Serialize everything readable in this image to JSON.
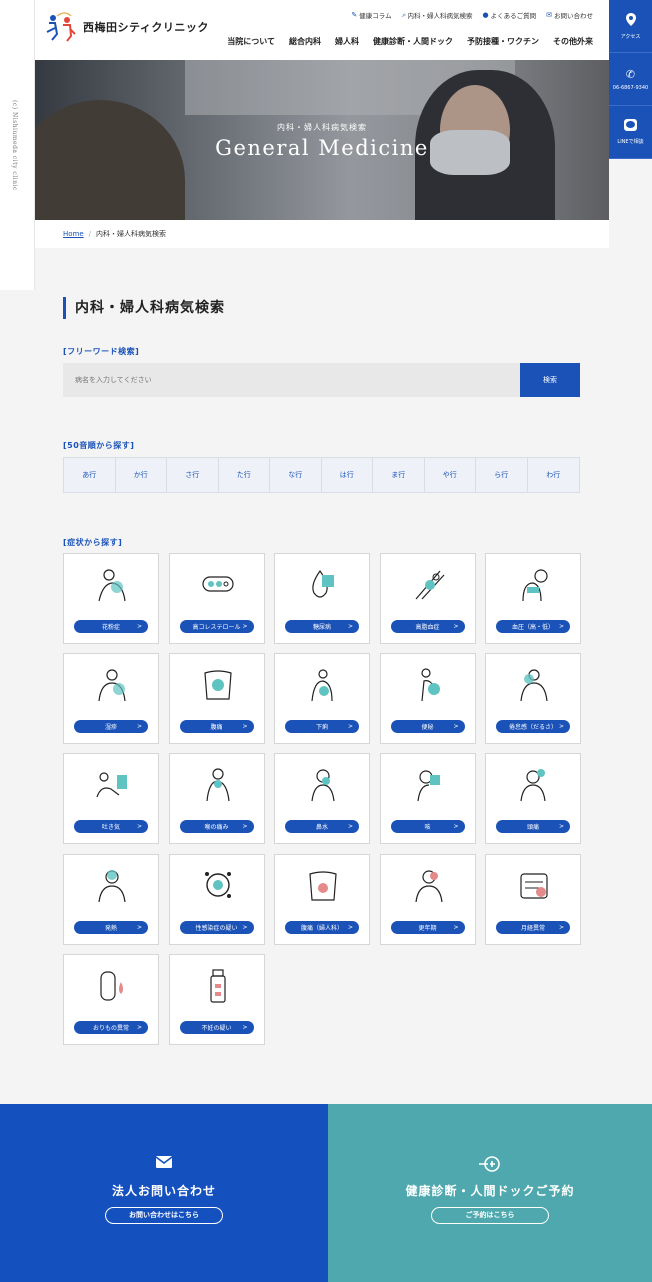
{
  "site": {
    "name": "西梅田シティクリニック",
    "copyright": "(c) Nishiumeda city clinic"
  },
  "utility_links": [
    "健康コラム",
    "内科・婦人科病気検索",
    "よくあるご質問",
    "お問い合わせ"
  ],
  "main_nav": [
    "当院について",
    "総合内科",
    "婦人科",
    "健康診断・人間ドック",
    "予防接種・ワクチン",
    "その他外来"
  ],
  "side_buttons": [
    {
      "label": "アクセス"
    },
    {
      "label": "06-6867-9340"
    },
    {
      "label": "LINEで相談"
    }
  ],
  "hero": {
    "subtitle": "内科・婦人科病気検索",
    "title": "General Medicine"
  },
  "breadcrumb": {
    "home": "Home",
    "current": "内科・婦人科病気検索"
  },
  "page_title": "内科・婦人科病気検索",
  "freeword": {
    "label": "[フリーワード検索]",
    "placeholder": "病名を入力してください",
    "button": "検索"
  },
  "gojuon": {
    "label": "[50音順から探す]",
    "items": [
      "あ行",
      "か行",
      "さ行",
      "た行",
      "な行",
      "は行",
      "ま行",
      "や行",
      "ら行",
      "わ行"
    ]
  },
  "symptoms": {
    "label": "[症状から探す]",
    "items": [
      "花粉症",
      "高コレステロール",
      "糖尿病",
      "高脂血症",
      "血圧（高・低）",
      "湿疹",
      "腹痛",
      "下痢",
      "便秘",
      "倦怠感（だるさ）",
      "吐き気",
      "喉の痛み",
      "鼻水",
      "咳",
      "頭痛",
      "発熱",
      "性感染症の疑い",
      "腹痛（婦人科）",
      "更年期",
      "月経異常",
      "おりもの異常",
      "不妊の疑い"
    ]
  },
  "cta": {
    "corporate": {
      "title": "法人お問い合わせ",
      "button": "お問い合わせはこちら"
    },
    "checkup": {
      "title": "健康診断・人間ドックご予約",
      "button": "ご予約はこちら"
    }
  },
  "colors": {
    "primary": "#1a52b8",
    "teal": "#4ea8ad",
    "accent_icon": "#5fc3c2"
  }
}
